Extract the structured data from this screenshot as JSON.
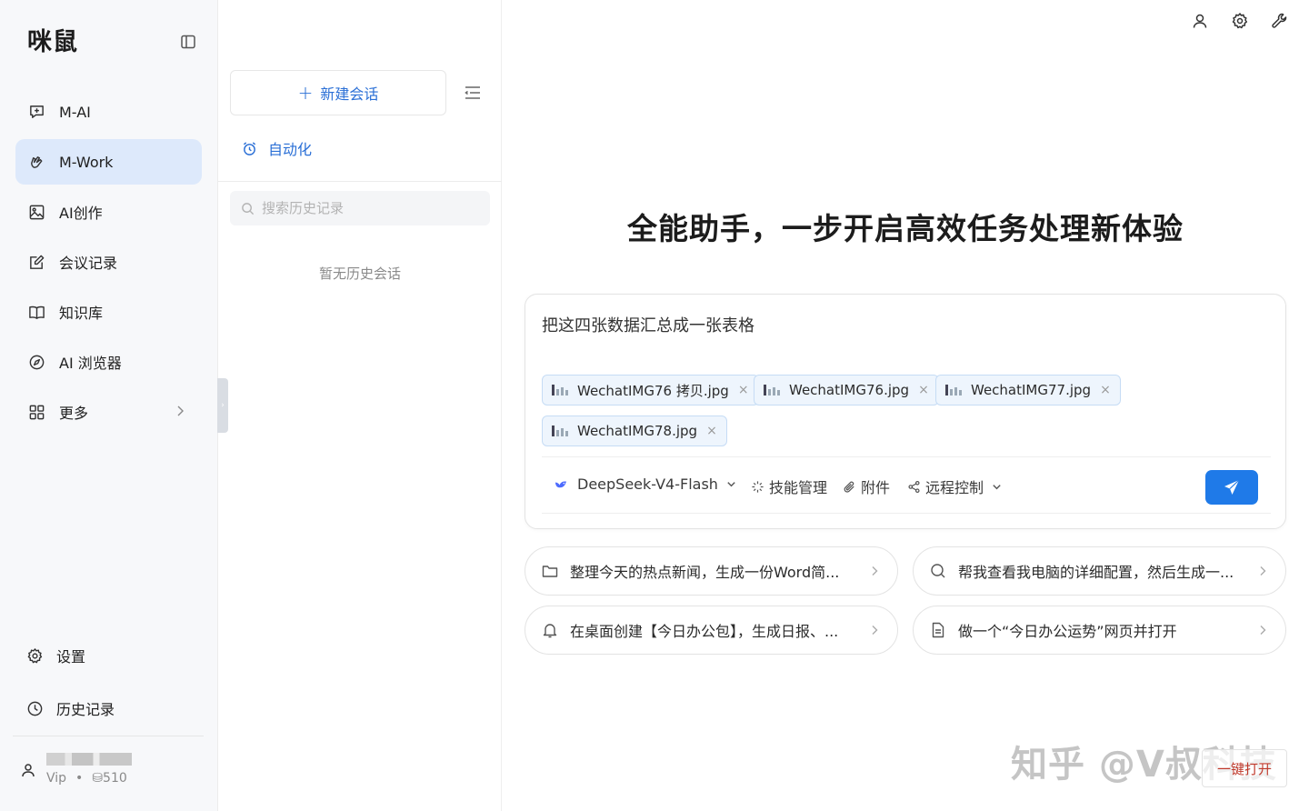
{
  "app": {
    "logo": "咪鼠"
  },
  "sidebar": {
    "items": [
      {
        "label": "M-AI",
        "icon": "chat-plus-icon"
      },
      {
        "label": "M-Work",
        "icon": "hand-icon",
        "active": true
      },
      {
        "label": "AI创作",
        "icon": "image-icon"
      },
      {
        "label": "会议记录",
        "icon": "edit-note-icon"
      },
      {
        "label": "知识库",
        "icon": "book-icon"
      },
      {
        "label": "AI 浏览器",
        "icon": "compass-icon"
      },
      {
        "label": "更多",
        "icon": "grid-icon"
      }
    ],
    "bottom": {
      "settings": "设置",
      "history": "历史记录"
    },
    "user": {
      "tier": "Vip",
      "dot": "•",
      "credits": "⛁510"
    }
  },
  "sessions": {
    "new_chat": "新建会话",
    "new_chat_plus": "+",
    "automation": "自动化",
    "search_placeholder": "搜索历史记录",
    "empty": "暂无历史会话"
  },
  "main": {
    "headline": "全能助手，一步开启高效任务处理新体验",
    "prompt": "把这四张数据汇总成一张表格",
    "attachments": [
      "WechatIMG76 拷贝.jpg",
      "WechatIMG76.jpg",
      "WechatIMG77.jpg",
      "WechatIMG78.jpg"
    ],
    "remove_symbol": "×",
    "toolbar": {
      "model": "DeepSeek-V4-Flash",
      "skills": "技能管理",
      "attach": "附件",
      "remote": "远程控制"
    },
    "suggestions": [
      {
        "text": "整理今天的热点新闻，生成一份Word简...",
        "icon": "folder-icon"
      },
      {
        "text": "帮我查看我电脑的详细配置，然后生成一...",
        "icon": "search-icon"
      },
      {
        "text": "在桌面创建【今日办公包】，生成日报、...",
        "icon": "bell-icon"
      },
      {
        "text": "做一个“今日办公运势”网页并打开",
        "icon": "document-icon"
      }
    ]
  },
  "overlay": {
    "watermark": "知乎 @V叔科技",
    "stamp": "一键打开"
  },
  "colors": {
    "accent": "#2a6fd6",
    "send": "#1f7ae8",
    "active_nav": "#dde9fb"
  }
}
